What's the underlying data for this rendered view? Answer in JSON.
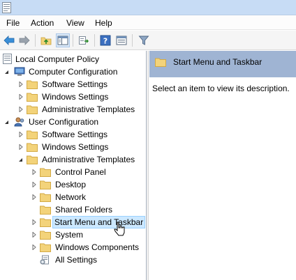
{
  "menu": {
    "file": "File",
    "action": "Action",
    "view": "View",
    "help": "Help"
  },
  "toolbar": {
    "buttons": [
      "back-icon",
      "forward-icon",
      "up-folder-icon",
      "show-hide-tree-icon",
      "export-list-icon",
      "help-icon",
      "properties-icon",
      "filter-icon"
    ]
  },
  "tree": {
    "root": "Local Computer Policy",
    "computer_config": "Computer Configuration",
    "cc_software": "Software Settings",
    "cc_windows": "Windows Settings",
    "cc_admin": "Administrative Templates",
    "user_config": "User Configuration",
    "uc_software": "Software Settings",
    "uc_windows": "Windows Settings",
    "uc_admin": "Administrative Templates",
    "control_panel": "Control Panel",
    "desktop": "Desktop",
    "network": "Network",
    "shared_folders": "Shared Folders",
    "start_menu": "Start Menu and Taskbar",
    "system": "System",
    "windows_components": "Windows Components",
    "all_settings": "All Settings"
  },
  "details": {
    "title": "Start Menu and Taskbar",
    "description": "Select an item to view its description."
  },
  "colors": {
    "folder": "#f3d37a",
    "selection_bg": "#cce8ff",
    "selection_border": "#99d1ff",
    "details_header": "#9fb4d3"
  }
}
